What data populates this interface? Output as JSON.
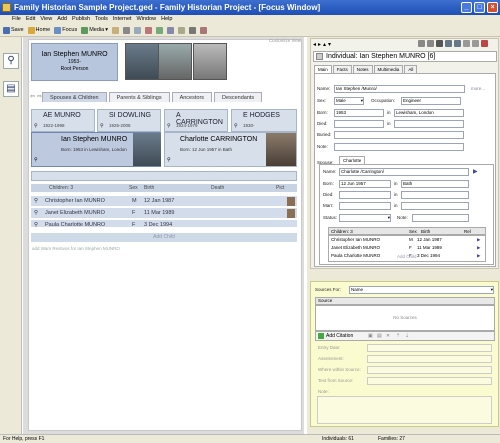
{
  "window": {
    "title": "Family Historian Sample Project.ged - Family Historian Project - [Focus Window]"
  },
  "menu": [
    "File",
    "Edit",
    "View",
    "Add",
    "Publish",
    "Tools",
    "Internet",
    "Window",
    "Help"
  ],
  "toolbar": {
    "save": "Save",
    "home": "Home",
    "focus": "Focus",
    "media": "Media"
  },
  "focus": {
    "customize_view": "Customize View",
    "name": "Ian Stephen MUNRO",
    "dates": "1953-",
    "role": "Root Person",
    "tabs": [
      "Spouses & Children",
      "Parents & Siblings",
      "Ancestors",
      "Descendants"
    ],
    "grandparents": [
      {
        "name": "AE MUNRO",
        "dates": "1922-1998"
      },
      {
        "name": "SI DOWLING",
        "dates": "1925-2008"
      },
      {
        "name": "A CARRINGTON",
        "dates": "1924-1979"
      },
      {
        "name": "E HODGES",
        "dates": "1930-"
      }
    ],
    "person": {
      "name": "Ian Stephen MUNRO",
      "detail": "Born:   1953 in Lewisham, London"
    },
    "spouse": {
      "name": "Charlotte CARRINGTON",
      "detail": "Born: 12 Jun 1957 in Bath"
    },
    "children_headers": {
      "children": "Children: 3",
      "sex": "Sex",
      "birth": "Birth",
      "death": "Death",
      "pic": "Pict"
    },
    "children": [
      {
        "name": "Christopher Ian MUNRO",
        "sex": "M",
        "birth": "12 Jan 1987"
      },
      {
        "name": "Janet Elizabeth MUNRO",
        "sex": "F",
        "birth": "11 Mar 1989"
      },
      {
        "name": "Paula Charlotte MUNRO",
        "sex": "F",
        "birth": "3 Dec 1994"
      }
    ],
    "add_child": "Add Child",
    "add_from": "add Wam Restivos for Ian Stephen MUNRO"
  },
  "property": {
    "title": "Individual: Ian Stephen MUNRO [6]",
    "tabs": [
      "Main",
      "Facts",
      "Notes",
      "Multimedia",
      "All"
    ],
    "name_label": "Name:",
    "name_value": "Ian Stephen /Munro/",
    "more": "more...",
    "sex_label": "Sex:",
    "sex_value": "Male",
    "occupation_label": "Occupation:",
    "occupation_value": "Engineer",
    "born_label": "Born:",
    "born_value": "1953",
    "born_place": "Lewisham, London",
    "died_label": "Died:",
    "died_value": "",
    "buried_label": "Buried:",
    "note_label": "Note:",
    "spouse_label": "Spouse:",
    "spouse_tab": "Charlotte",
    "sp_name_label": "Name:",
    "sp_name_value": "Charlotte /Carrington/",
    "sp_born_label": "Born:",
    "sp_born_value": "12 Jun 1957",
    "sp_born_place": "Bath",
    "sp_died_label": "Died:",
    "sp_marr_label": "Marr:",
    "status_label": "Status:",
    "note2_label": "Note:",
    "in_label": "in",
    "children_headers": {
      "children": "Children: 3",
      "sex": "Sex",
      "birth": "Birth",
      "rel": "Rel"
    },
    "add_child": "Add Child"
  },
  "sources": {
    "for_label": "Sources For:",
    "for_value": "Name",
    "col_source": "Source",
    "no_sources": "No Sources",
    "add_citation": "Add Citation",
    "fields": [
      "Entry Date:",
      "Assessment:",
      "Where within Source:",
      "Text from Source:",
      "Note:"
    ]
  },
  "status": {
    "help": "For Help, press F1",
    "individuals": "Individuals: 61",
    "families": "Families: 27"
  }
}
